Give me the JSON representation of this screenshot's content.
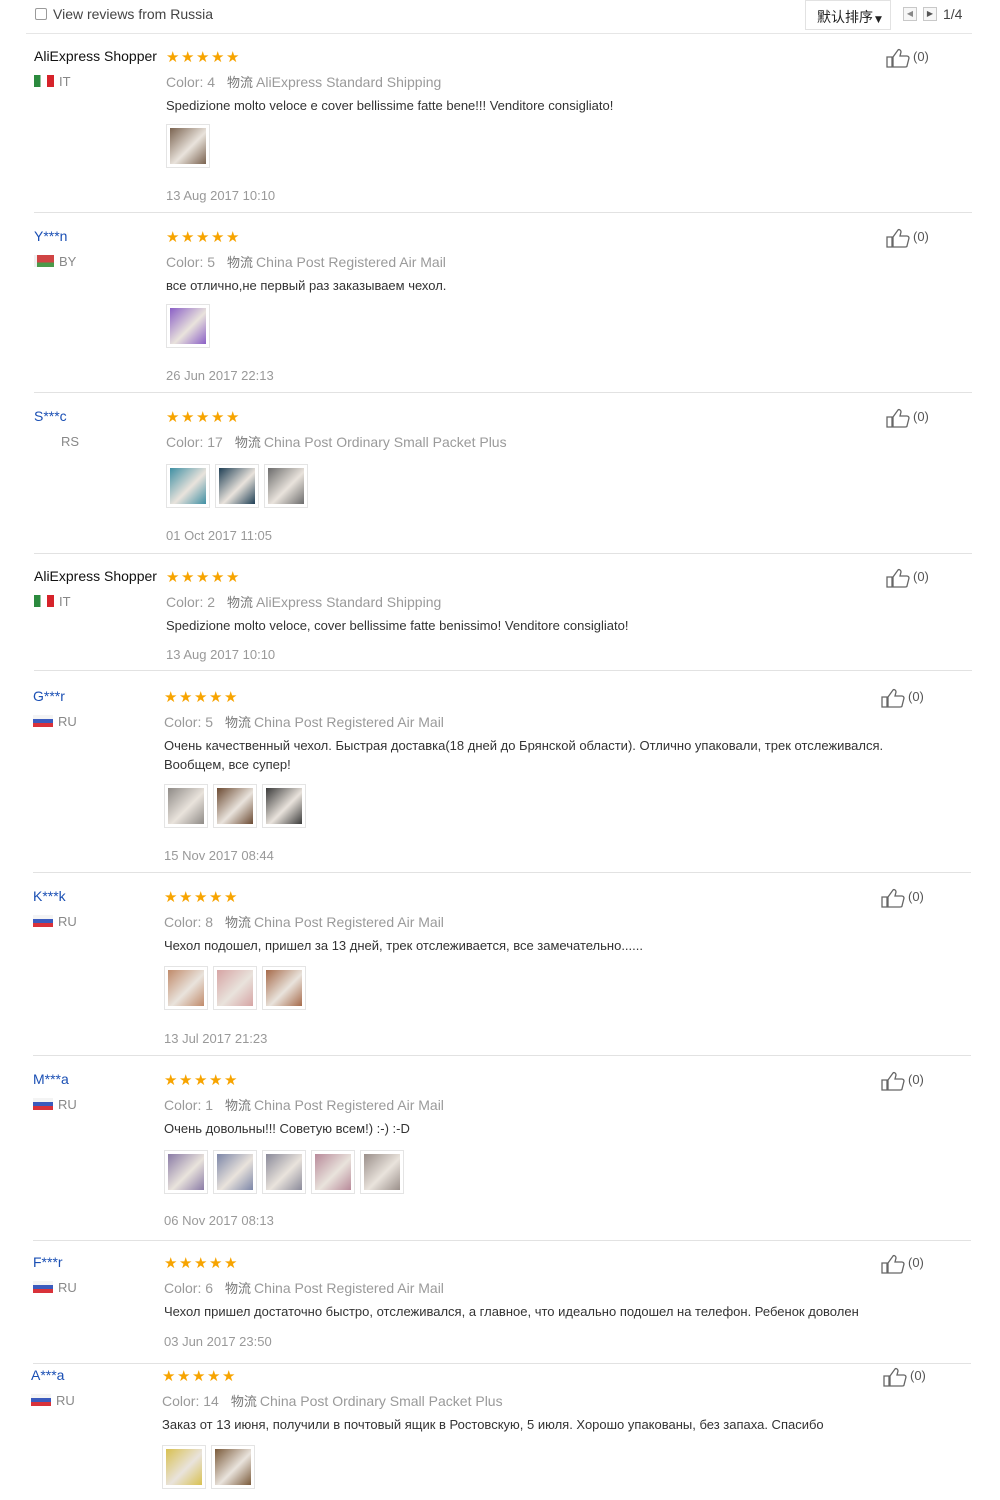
{
  "header": {
    "view_reviews_label": "View reviews from Russia",
    "sort_label": "默认排序",
    "page_label": "1/4"
  },
  "star_glyph": "★",
  "colors": {
    "link_blue": "#1a4fb4",
    "star_orange": "#f7a400",
    "muted_gray": "#999999"
  },
  "reviews": [
    {
      "user": "AliExpress Shopper",
      "country": "IT",
      "color": "Color: 4",
      "ship_icon": "物流",
      "shipping": "AliExpress Standard Shipping",
      "text": "Spedizione molto veloce e cover bellissime fatte bene!!! Venditore consigliato!",
      "photos": [
        "#7a6350"
      ],
      "date": "13 Aug 2017 10:10",
      "likes": "(0)",
      "rating": 5
    },
    {
      "user": "Y***n",
      "country": "BY",
      "color": "Color: 5",
      "ship_icon": "物流",
      "shipping": "China Post Registered Air Mail",
      "text": "все отлично,не первый раз заказываем чехол.",
      "photos": [
        "#8a5fc6"
      ],
      "date": "26 Jun 2017 22:13",
      "likes": "(0)",
      "rating": 5
    },
    {
      "user": "S***c",
      "country": "RS",
      "color": "Color: 17",
      "ship_icon": "物流",
      "shipping": "China Post Ordinary Small Packet Plus",
      "text": "",
      "photos": [
        "#3f8fa3",
        "#1f3f55",
        "#6b6b6b"
      ],
      "date": "01 Oct 2017 11:05",
      "likes": "(0)",
      "rating": 5
    },
    {
      "user": "AliExpress Shopper",
      "country": "IT",
      "color": "Color: 2",
      "ship_icon": "物流",
      "shipping": "AliExpress Standard Shipping",
      "text": "Spedizione molto veloce, cover bellissime fatte benissimo! Venditore consigliato!",
      "photos": [],
      "date": "13 Aug 2017 10:10",
      "likes": "(0)",
      "rating": 5
    },
    {
      "user": "G***r",
      "country": "RU",
      "color": "Color: 5",
      "ship_icon": "物流",
      "shipping": "China Post Registered Air Mail",
      "text": "Очень качественный чехол. Быстрая доставка(18 дней до Брянской области). Отлично упаковали, трек отслеживался. Вообщем, все супер!",
      "photos": [
        "#8e8a86",
        "#6b4a32",
        "#3a3a3a"
      ],
      "date": "15 Nov 2017 08:44",
      "likes": "(0)",
      "rating": 5
    },
    {
      "user": "K***k",
      "country": "RU",
      "color": "Color: 8",
      "ship_icon": "物流",
      "shipping": "China Post Registered Air Mail",
      "text": "Чехол подошел, пришел за 13 дней, трек отслеживается, все замечательно......",
      "photos": [
        "#c08a6a",
        "#d6a4a4",
        "#a66a4a"
      ],
      "date": "13 Jul 2017 21:23",
      "likes": "(0)",
      "rating": 5
    },
    {
      "user": "M***a",
      "country": "RU",
      "color": "Color: 1",
      "ship_icon": "物流",
      "shipping": "China Post Registered Air Mail",
      "text": "Очень довольны!!! Советую всем!) :-) :-D",
      "photos": [
        "#8a7ba6",
        "#7c86a8",
        "#8a8a9a",
        "#b88a9a",
        "#9a8f8a"
      ],
      "date": "06 Nov 2017 08:13",
      "likes": "(0)",
      "rating": 5
    },
    {
      "user": "F***r",
      "country": "RU",
      "color": "Color: 6",
      "ship_icon": "物流",
      "shipping": "China Post Registered Air Mail",
      "text": "Чехол пришел достаточно быстро, отслеживался, а главное, что идеально подошел на телефон. Ребенок доволен",
      "photos": [],
      "date": "03 Jun 2017 23:50",
      "likes": "(0)",
      "rating": 5
    },
    {
      "user": "A***a",
      "country": "RU",
      "color": "Color: 14",
      "ship_icon": "物流",
      "shipping": "China Post Ordinary Small Packet Plus",
      "text": "Заказ от 13 июня, получили в почтовый ящик в Ростовскую, 5 июля. Хорошо упакованы, без запаха. Спасибо",
      "photos": [
        "#d8c050",
        "#7a5a3a"
      ],
      "date": "",
      "likes": "(0)",
      "rating": 5
    }
  ]
}
